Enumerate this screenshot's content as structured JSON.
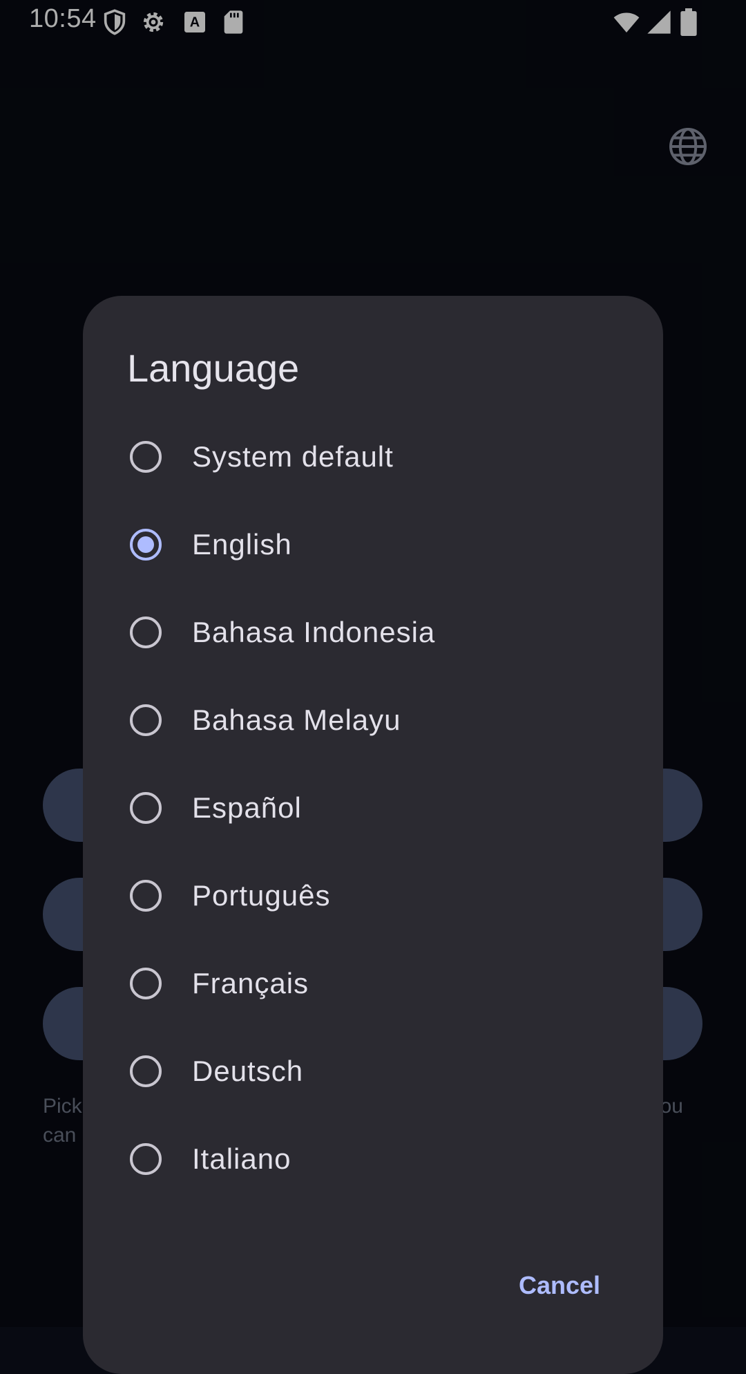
{
  "status_bar": {
    "time": "10:54",
    "icons": [
      "shield-icon",
      "settings-icon",
      "autofill-icon",
      "sd-card-icon",
      "wifi-icon",
      "cell-signal-icon",
      "battery-icon"
    ]
  },
  "background": {
    "language_icon": "globe-icon",
    "hint_left": [
      "Pick",
      "can"
    ],
    "hint_right": [
      "ou",
      ""
    ]
  },
  "dialog": {
    "title": "Language",
    "options": [
      {
        "label": "System default",
        "selected": false
      },
      {
        "label": "English",
        "selected": true
      },
      {
        "label": "Bahasa Indonesia",
        "selected": false
      },
      {
        "label": "Bahasa Melayu",
        "selected": false
      },
      {
        "label": "Español",
        "selected": false
      },
      {
        "label": "Português",
        "selected": false
      },
      {
        "label": "Français",
        "selected": false
      },
      {
        "label": "Deutsch",
        "selected": false
      },
      {
        "label": "Italiano",
        "selected": false
      }
    ],
    "cancel_label": "Cancel"
  },
  "colors": {
    "accent": "#aebcff",
    "dialog_bg": "#2b2a31",
    "screen_bg": "#080a12"
  }
}
